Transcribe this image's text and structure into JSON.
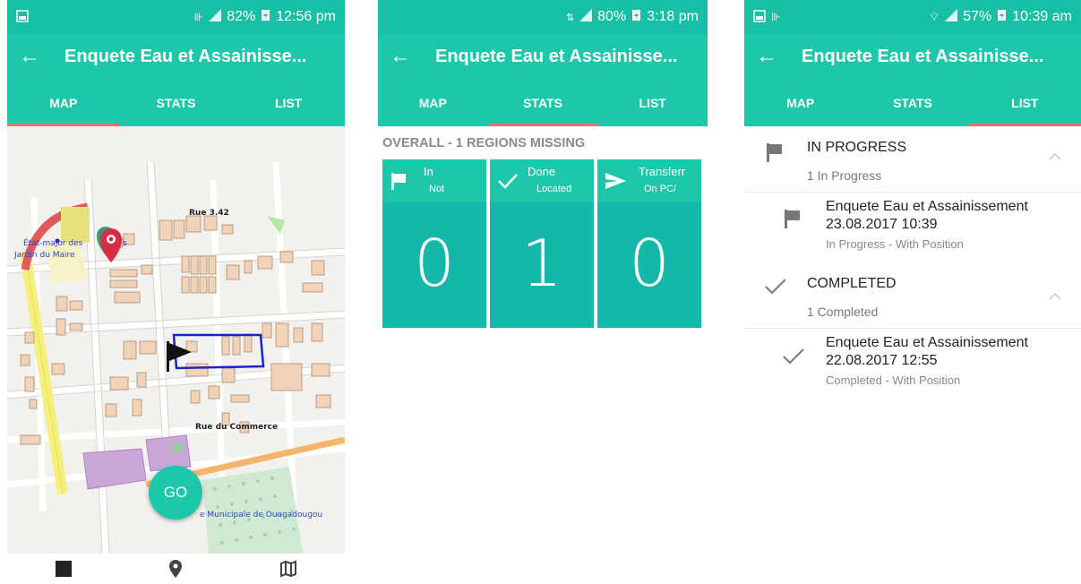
{
  "screens": [
    {
      "status": {
        "time": "12:56 pm",
        "battery": "82%"
      },
      "appbar": {
        "title": "Enquete Eau et Assainisse..."
      },
      "tabs": [
        {
          "label": "MAP"
        },
        {
          "label": "STATS"
        },
        {
          "label": "LIST"
        }
      ],
      "active_tab": "MAP",
      "map": {
        "labels": {
          "rue_342": "Rue 3.42",
          "etat_major": "État-major des",
          "etat_major_tail": "s",
          "jardin": "Jardin du Maire",
          "rue_commerce": "Rue du Commerce",
          "municipale": "e Municipale de Ouagadougou"
        }
      },
      "go_label": "GO",
      "bottom_nav": [
        "square-icon",
        "location-pin-icon",
        "map-icon"
      ]
    },
    {
      "status": {
        "time": "3:18 pm",
        "battery": "80%"
      },
      "appbar": {
        "title": "Enquete Eau et Assainisse..."
      },
      "tabs": [
        {
          "label": "MAP"
        },
        {
          "label": "STATS"
        },
        {
          "label": "LIST"
        }
      ],
      "active_tab": "STATS",
      "overall": "OVERALL - 1 REGIONS MISSING",
      "cards": [
        {
          "title": "In",
          "subtitle": "Not",
          "count": "0",
          "icon": "flag-icon"
        },
        {
          "title": "Done",
          "subtitle": "Located",
          "count": "1",
          "icon": "check-icon"
        },
        {
          "title": "Transferr",
          "subtitle": "On PC/",
          "count": "0",
          "icon": "send-icon"
        }
      ]
    },
    {
      "status": {
        "time": "10:39 am",
        "battery": "57%"
      },
      "appbar": {
        "title": "Enquete Eau et Assainisse..."
      },
      "tabs": [
        {
          "label": "MAP"
        },
        {
          "label": "STATS"
        },
        {
          "label": "LIST"
        }
      ],
      "active_tab": "LIST",
      "sections": [
        {
          "title": "IN PROGRESS",
          "count_label": "1 In Progress",
          "icon": "flag-icon",
          "items": [
            {
              "name": "Enquete Eau et Assainissement",
              "date": "23.08.2017 10:39",
              "status": "In Progress - With Position",
              "icon": "flag-icon"
            }
          ]
        },
        {
          "title": "COMPLETED",
          "count_label": "1 Completed",
          "icon": "check-icon",
          "items": [
            {
              "name": "Enquete Eau et Assainissement",
              "date": "22.08.2017 12:55",
              "status": "Completed - With Position",
              "icon": "check-icon"
            }
          ]
        }
      ]
    }
  ],
  "colors": {
    "primary": "#1cc7aa",
    "status_bar": "#17bfa5",
    "card_body": "#14b8aa",
    "tab_indicator": "#e57373"
  }
}
